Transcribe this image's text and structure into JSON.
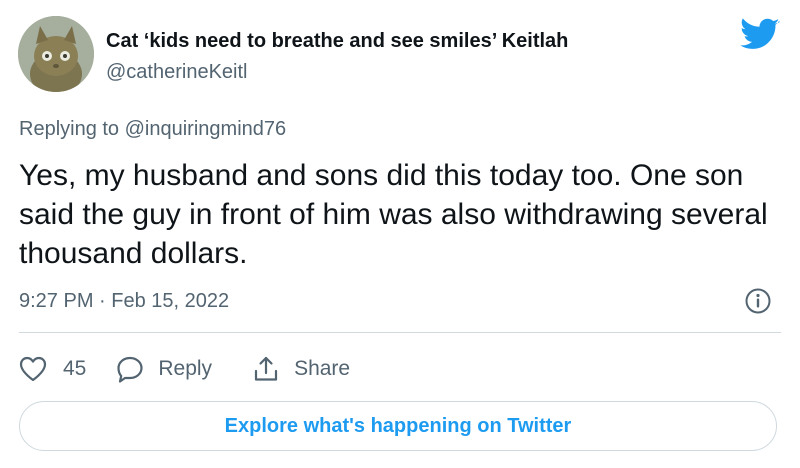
{
  "author": {
    "display_name": "Cat ‘kids need to breathe and see smiles’ Keitlah",
    "handle": "@catherineKeitl"
  },
  "tweet": {
    "replying_prefix": "Replying to ",
    "replying_to": "@inquiringmind76",
    "text": "Yes, my husband and sons did this today too.  One son said the guy in front of him was also withdrawing several thousand dollars.",
    "timestamp": "9:27 PM · Feb 15, 2022"
  },
  "actions": {
    "like_count": "45",
    "reply_label": "Reply",
    "share_label": "Share"
  },
  "explore_button": "Explore what's happening on Twitter",
  "icons": {
    "brand": "twitter-bird-icon",
    "info": "info-icon",
    "like": "heart-icon",
    "reply": "speech-bubble-icon",
    "share": "share-upload-icon"
  },
  "colors": {
    "brand_blue": "#1d9bf0",
    "text_primary": "#0f1419",
    "text_secondary": "#536471",
    "border": "#cfd9de"
  }
}
